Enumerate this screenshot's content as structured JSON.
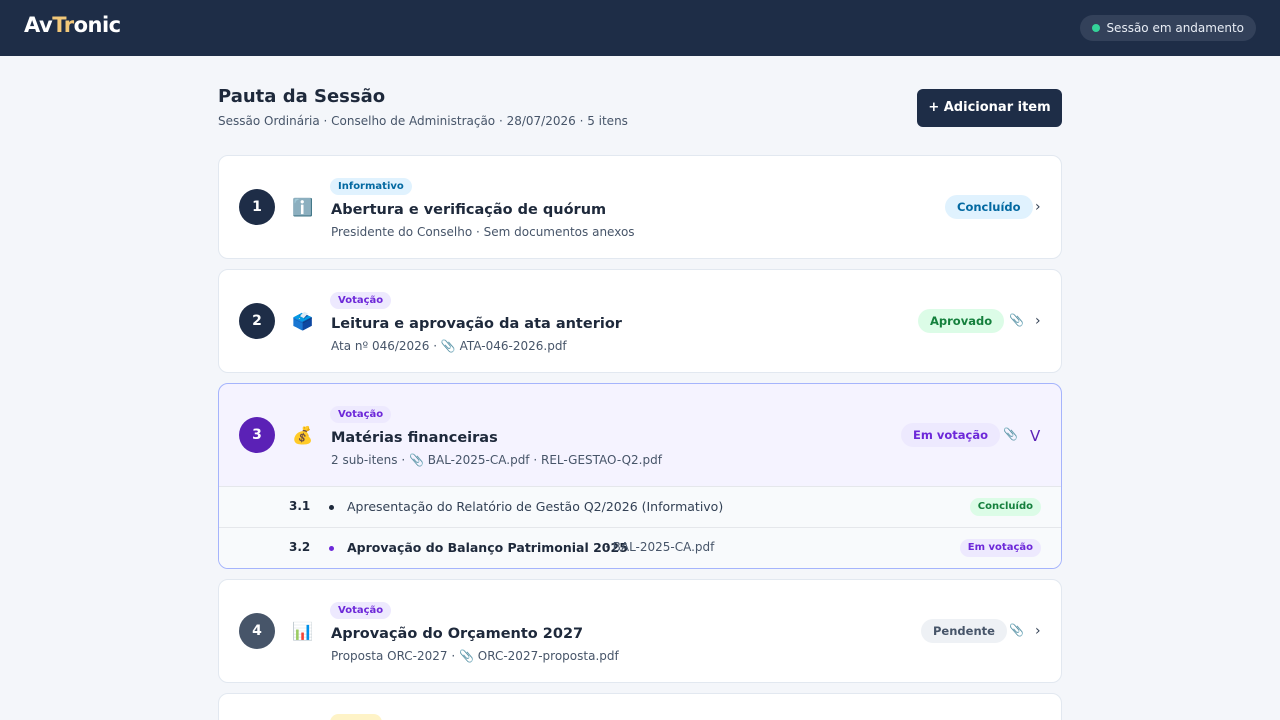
{
  "app": {
    "logo_prefix": "Av",
    "logo_accent": "Tr",
    "logo_suffix": "onic",
    "session_status": "Sessão em andamento"
  },
  "header": {
    "title": "Pauta da Sessão",
    "subtitle": "Sessão Ordinária · Conselho de Administração · 28/07/2026 · 5 itens",
    "add_button": "+ Adicionar item"
  },
  "items": [
    {
      "number": "1",
      "icon": "info-icon",
      "glyph": "ℹ️",
      "tag": "Informativo",
      "title": "Abertura e verificação de quórum",
      "meta": "Presidente do Conselho · Sem documentos anexos",
      "status": "Concluído",
      "chevron": "›"
    },
    {
      "number": "2",
      "icon": "ballot-box-icon",
      "glyph": "🗳️",
      "tag": "Votação",
      "title": "Leitura e aprovação da ata anterior",
      "meta": "Ata nº 046/2026 · ",
      "attachment": "ATA-046-2026.pdf",
      "status": "Aprovado",
      "chevron": "›"
    },
    {
      "number": "3",
      "icon": "money-bag-icon",
      "glyph": "💰",
      "tag": "Votação",
      "title": "Matérias financeiras",
      "meta": "2 sub-itens · ",
      "attachment": "BAL-2025-CA.pdf · REL-GESTAO-Q2.pdf",
      "status": "Em votação",
      "chevron": "V",
      "subitems": [
        {
          "number": "3.1",
          "text": "Apresentação do Relatório de Gestão Q2/2026 (Informativo)",
          "status": "Concluído"
        },
        {
          "number": "3.2",
          "text": "Aprovação do Balanço Patrimonial 2025",
          "attachment": "·  BAL-2025-CA.pdf",
          "status": "Em votação"
        }
      ]
    },
    {
      "number": "4",
      "icon": "bar-chart-icon",
      "glyph": "📊",
      "tag": "Votação",
      "title": "Aprovação do Orçamento 2027",
      "meta": "Proposta ORC-2027 · ",
      "attachment": "ORC-2027-proposta.pdf",
      "status": "Pendente",
      "chevron": "›"
    }
  ],
  "clip_glyph": "📎"
}
